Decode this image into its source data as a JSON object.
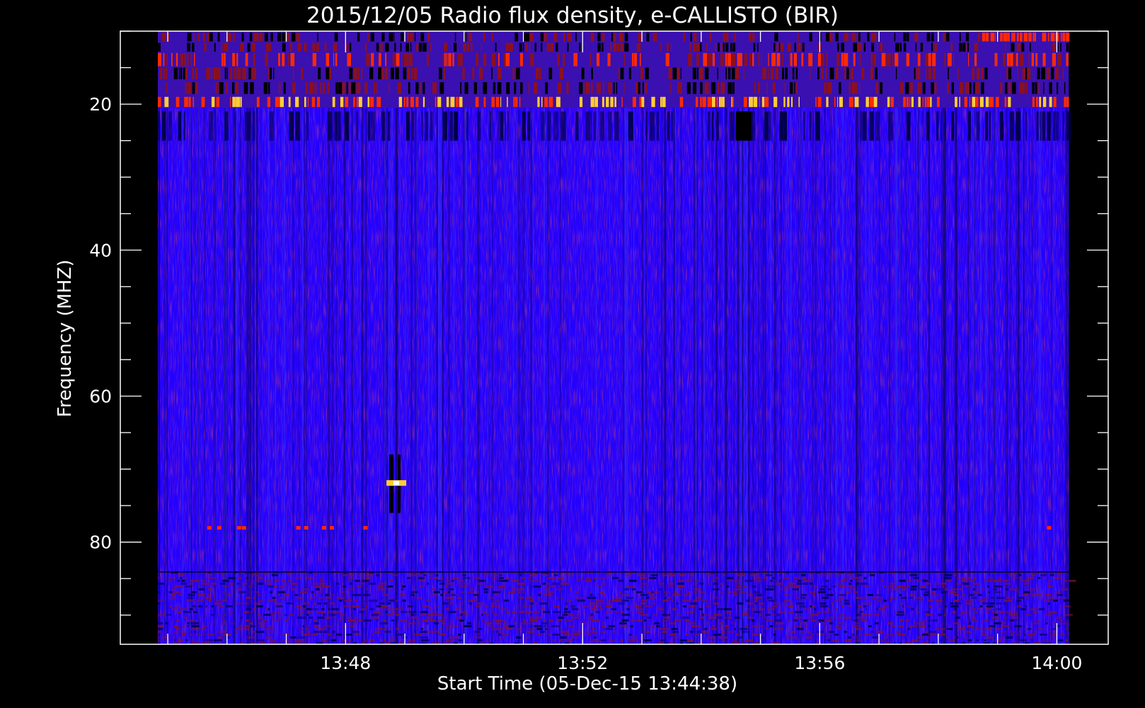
{
  "chart_data": {
    "type": "heatmap",
    "title": "2015/12/05  Radio flux density, e-CALLISTO (BIR)",
    "xlabel": "Start Time (05-Dec-15 13:44:38)",
    "ylabel": "Frequency (MHZ)",
    "x_ticks": [
      "13:48",
      "13:52",
      "13:56",
      "14:00"
    ],
    "y_ticks": [
      "20",
      "40",
      "60",
      "80"
    ],
    "x_tick_values_min": [
      228,
      468,
      708,
      948
    ],
    "x_minor_step_min": 60,
    "xlim_min": [
      0,
      1000
    ],
    "data_xlim_min": [
      38,
      960
    ],
    "ylim": [
      10,
      94
    ],
    "data_ylim": [
      10,
      94
    ],
    "y_reversed": true,
    "colormap": [
      "#000000",
      "#2200ff",
      "#8a1020",
      "#ff2a00",
      "#ffcc33",
      "#ffffff"
    ],
    "background": "#000000",
    "bands": [
      {
        "name": "rfi-top",
        "from": 10,
        "to": 20.5,
        "intensity": "high"
      },
      {
        "name": "dark-band",
        "from": 21,
        "to": 25,
        "intensity": "low"
      },
      {
        "name": "bottom-noise",
        "from": 84,
        "to": 94,
        "intensity": "mixed"
      }
    ],
    "hotspots": [
      {
        "time_min": 278,
        "freq": 72,
        "level": "max"
      },
      {
        "time_min": 264,
        "freq": 78,
        "level": "high"
      }
    ]
  }
}
